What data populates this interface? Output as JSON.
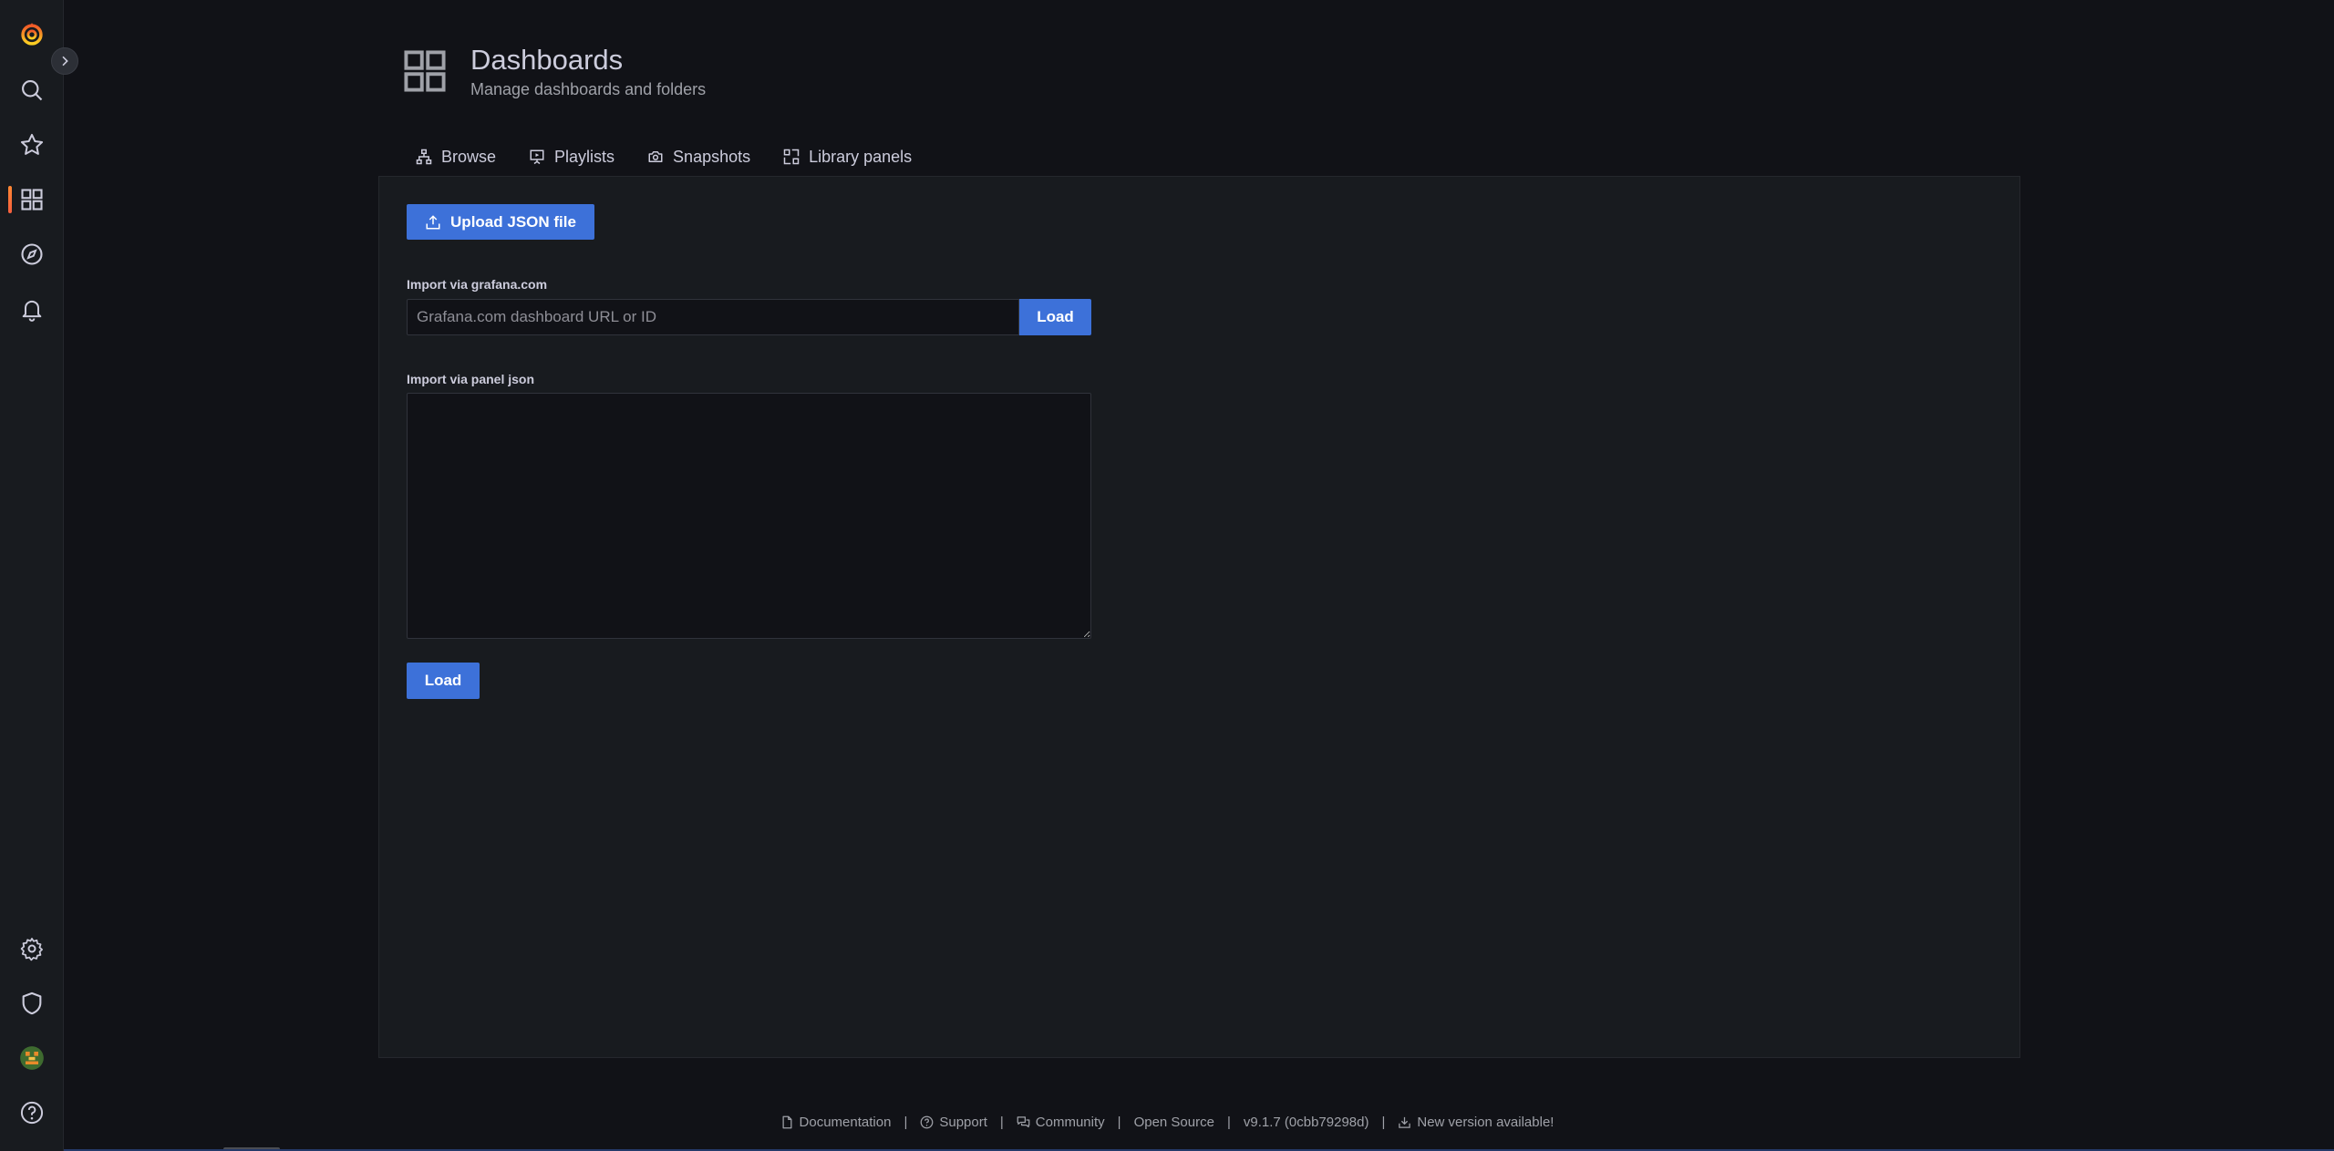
{
  "sidemenu": {
    "items": [
      {
        "name": "grafana-logo-icon"
      },
      {
        "name": "search-icon"
      },
      {
        "name": "star-icon"
      },
      {
        "name": "dashboards-icon"
      },
      {
        "name": "explore-compass-icon"
      },
      {
        "name": "alerting-bell-icon"
      },
      {
        "name": "gear-icon"
      },
      {
        "name": "shield-icon"
      },
      {
        "name": "avatar"
      },
      {
        "name": "help-icon"
      }
    ],
    "accent": "#f55f3e"
  },
  "header": {
    "title": "Dashboards",
    "subtitle": "Manage dashboards and folders"
  },
  "tabs": [
    {
      "label": "Browse"
    },
    {
      "label": "Playlists"
    },
    {
      "label": "Snapshots"
    },
    {
      "label": "Library panels"
    }
  ],
  "import": {
    "upload_label": "Upload JSON file",
    "grafana_label": "Import via grafana.com",
    "grafana_placeholder": "Grafana.com dashboard URL or ID",
    "grafana_load_label": "Load",
    "panel_json_label": "Import via panel json",
    "panel_json_value": "",
    "panel_load_label": "Load"
  },
  "footer": {
    "documentation": "Documentation",
    "support": "Support",
    "community": "Community",
    "open_source": "Open Source",
    "version": "v9.1.7 (0cbb79298d)",
    "new_version": "New version available!",
    "separator": "|"
  },
  "colors": {
    "primary": "#3d71d9",
    "background": "#111217",
    "panel": "#181b1f"
  }
}
